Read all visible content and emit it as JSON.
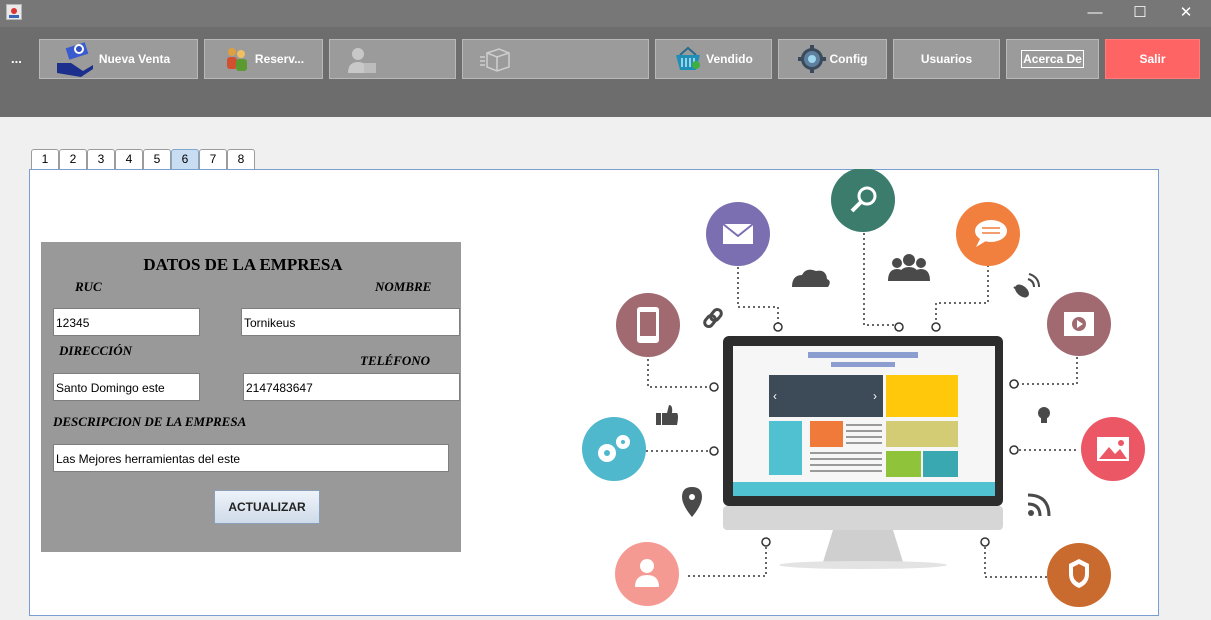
{
  "window": {
    "minimize_glyph": "—",
    "maximize_glyph": "☐",
    "close_glyph": "✕"
  },
  "toolbar": {
    "overflow_label": "...",
    "buttons": {
      "nueva_venta": "Nueva Venta",
      "reservas": "Reserv...",
      "vendido": "Vendido",
      "config": "Config",
      "usuarios": "Usuarios",
      "acerca_de": "Acerca De",
      "salir": "Salir"
    }
  },
  "tabs": [
    "1",
    "2",
    "3",
    "4",
    "5",
    "6",
    "7",
    "8"
  ],
  "active_tab": "6",
  "form": {
    "title": "DATOS DE LA EMPRESA",
    "ruc_label": "RUC",
    "nombre_label": "NOMBRE",
    "direccion_label": "DIRECCIÓN",
    "telefono_label": "TELÉFONO",
    "descripcion_label": "DESCRIPCION DE LA EMPRESA",
    "ruc_value": "12345",
    "nombre_value": "Tornikeus",
    "direccion_value": "Santo Domingo este",
    "telefono_value": "2147483647",
    "descripcion_value": "Las Mejores herramientas del este",
    "submit_label": "ACTUALIZAR"
  },
  "colors": {
    "titlebar": "#777777",
    "toolbar": "#6d6d6d",
    "button": "#9b9b9b",
    "salir": "#ff6464",
    "form_bg": "#999999"
  },
  "illustration": {
    "icons": [
      "mail-icon",
      "search-icon",
      "chat-icon",
      "mobile-icon",
      "video-icon",
      "gears-icon",
      "image-icon",
      "user-icon",
      "shield-icon",
      "cloud-icon",
      "group-icon",
      "satellite-icon",
      "link-icon",
      "thumbs-up-icon",
      "bulb-icon",
      "location-icon",
      "rss-icon",
      "monitor-icon"
    ]
  }
}
